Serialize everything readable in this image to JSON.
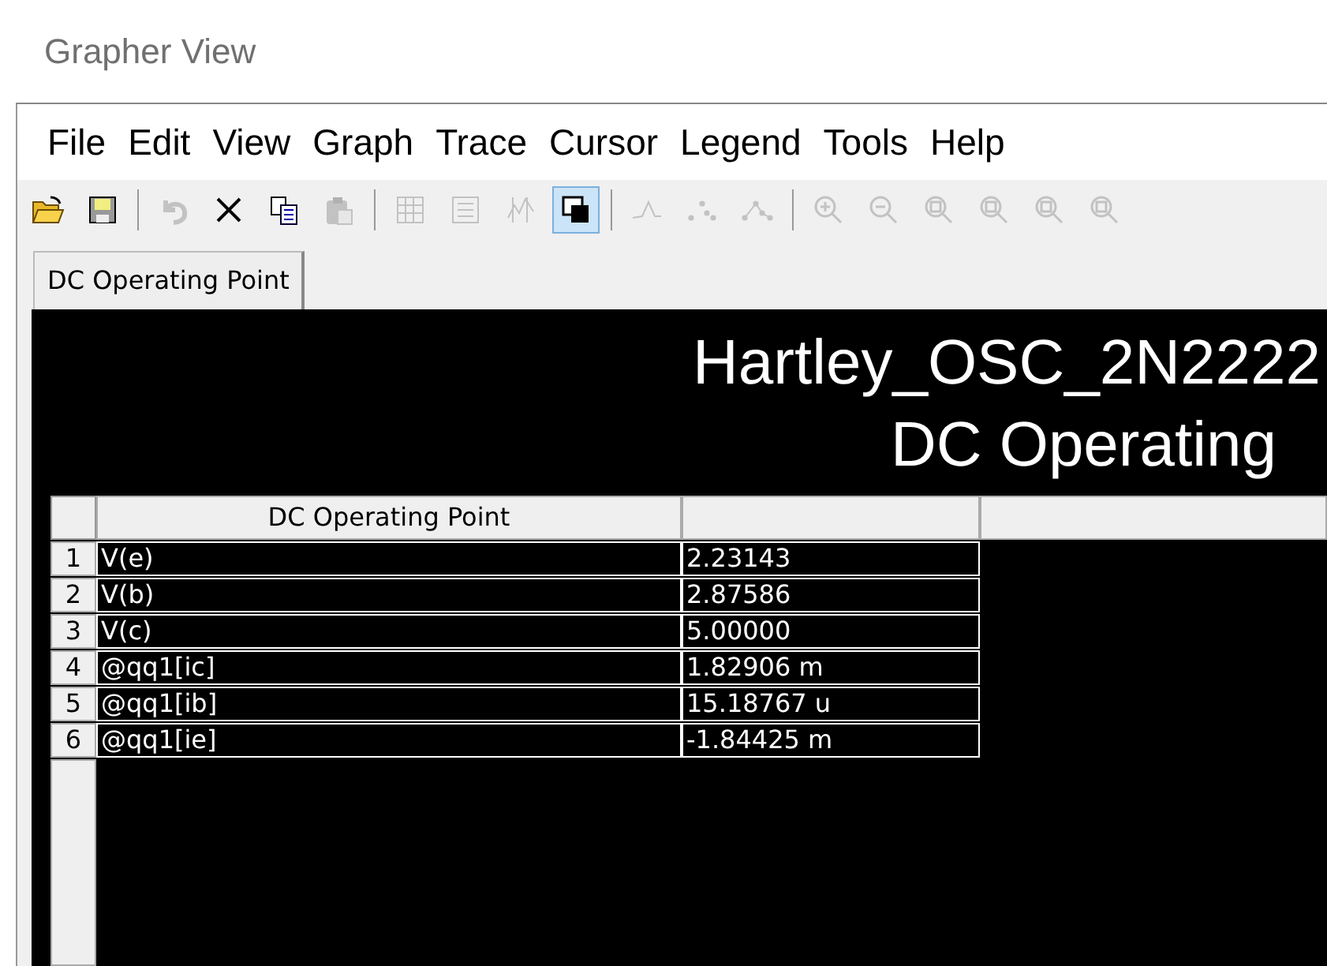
{
  "window": {
    "title": "Grapher View"
  },
  "menu": [
    "File",
    "Edit",
    "View",
    "Graph",
    "Trace",
    "Cursor",
    "Legend",
    "Tools",
    "Help"
  ],
  "toolbar": [
    {
      "buttons": [
        {
          "kind": "open",
          "disabled": false
        },
        {
          "kind": "save",
          "disabled": false
        }
      ]
    },
    {
      "buttons": [
        {
          "kind": "undo",
          "disabled": true
        },
        {
          "kind": "delete",
          "disabled": false
        },
        {
          "kind": "copy",
          "disabled": false
        },
        {
          "kind": "paste",
          "disabled": true
        }
      ]
    },
    {
      "buttons": [
        {
          "kind": "grid",
          "disabled": true,
          "selected": false
        },
        {
          "kind": "legend",
          "disabled": true,
          "selected": false
        },
        {
          "kind": "cursors",
          "disabled": true,
          "selected": false
        },
        {
          "kind": "overlay",
          "disabled": false,
          "selected": true
        }
      ]
    },
    {
      "buttons": [
        {
          "kind": "lines",
          "disabled": true
        },
        {
          "kind": "points",
          "disabled": true
        },
        {
          "kind": "linepoints",
          "disabled": true
        }
      ]
    },
    {
      "buttons": [
        {
          "kind": "zoomin",
          "disabled": true
        },
        {
          "kind": "zoomout",
          "disabled": true
        },
        {
          "kind": "zoom",
          "disabled": true
        },
        {
          "kind": "zoom",
          "disabled": true
        },
        {
          "kind": "zoom",
          "disabled": true
        },
        {
          "kind": "zoom",
          "disabled": true
        }
      ]
    }
  ],
  "tabs": [
    {
      "label": "DC Operating Point",
      "selected": true
    }
  ],
  "graph": {
    "title": "Hartley_OSC_2N2222",
    "subtitle": "DC Operating",
    "table": {
      "columns": [
        "DC Operating Point"
      ],
      "rows": [
        {
          "index": "1",
          "name": "V(e)",
          "value": "2.23143"
        },
        {
          "index": "2",
          "name": "V(b)",
          "value": "2.87586"
        },
        {
          "index": "3",
          "name": "V(c)",
          "value": "5.00000"
        },
        {
          "index": "4",
          "name": "@qq1[ic]",
          "value": "1.82906 m"
        },
        {
          "index": "5",
          "name": "@qq1[ib]",
          "value": "15.18767 u"
        },
        {
          "index": "6",
          "name": "@qq1[ie]",
          "value": "-1.84425 m"
        }
      ]
    }
  }
}
